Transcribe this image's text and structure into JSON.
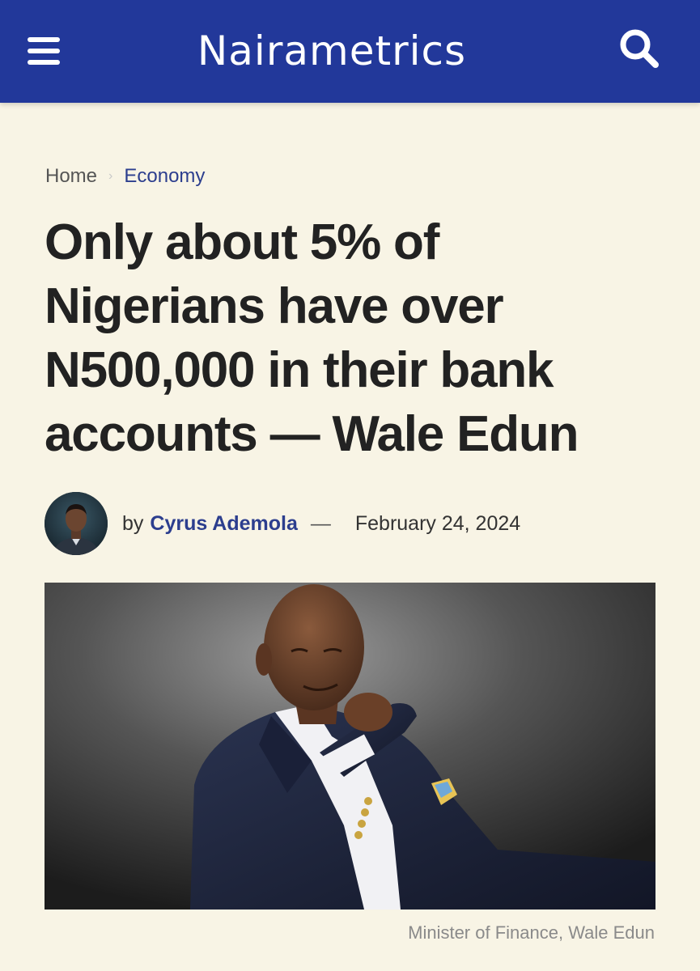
{
  "header": {
    "logo_text": "Nairametrics",
    "brand_color": "#22389a",
    "menu_icon": "hamburger-menu-icon",
    "search_icon": "search-icon"
  },
  "breadcrumb": {
    "home": "Home",
    "separator": "›",
    "current": "Economy"
  },
  "article": {
    "title": "Only about 5% of Nigerians have over N500,000 in their bank accounts — Wale Edun",
    "byline_prefix": "by",
    "author": "Cyrus Ademola",
    "separator": "—",
    "date": "February 24, 2024",
    "image_caption": "Minister of Finance, Wale Edun"
  }
}
